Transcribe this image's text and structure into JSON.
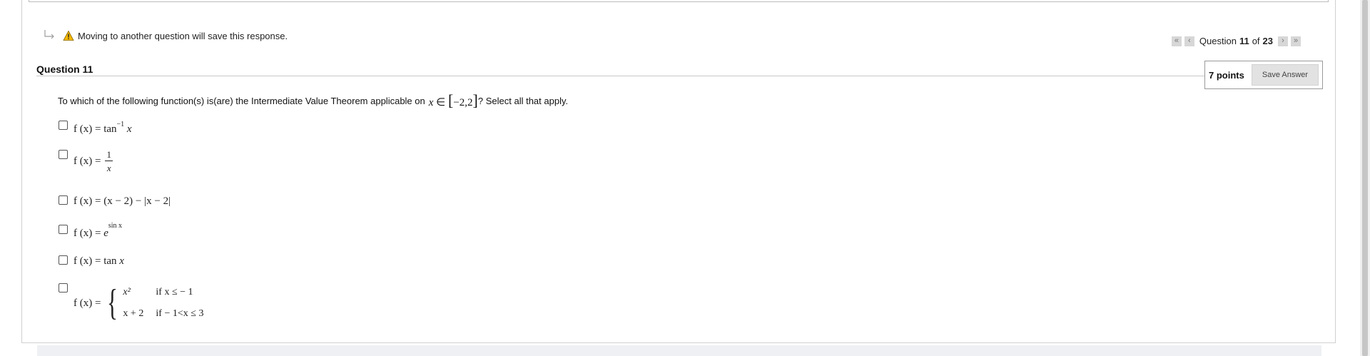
{
  "warning": {
    "text": "Moving to another question will save this response."
  },
  "nav": {
    "first": "«",
    "prev": "‹",
    "label_prefix": "Question",
    "current": "11",
    "label_of": "of",
    "total": "23",
    "next": "›",
    "last": "»"
  },
  "question": {
    "title": "Question 11",
    "points": "7 points",
    "save_label": "Save Answer",
    "prompt_before": "To which of the following function(s) is(are) the Intermediate Value Theorem applicable on",
    "prompt_after": "? Select all that apply.",
    "interval": {
      "var": "x",
      "op": "∈",
      "open": "[",
      "content": "−2,2",
      "close": "]"
    }
  },
  "options": [
    {
      "lhs": "f (x) = ",
      "fn": "tan",
      "sup": "−1",
      "arg": "x"
    },
    {
      "lhs": "f (x) = ",
      "num": "1",
      "den": "x"
    },
    {
      "lhs": "f (x) = ",
      "text": "(x − 2) − |x − 2|"
    },
    {
      "lhs": "f (x) = ",
      "base": "e",
      "sup": "sin x"
    },
    {
      "lhs": "f (x) = ",
      "fn": "tan",
      "arg": "x"
    },
    {
      "lhs": "f (x) = ",
      "cases": [
        {
          "expr": "x²",
          "cond": "if x ≤ − 1"
        },
        {
          "expr": "x + 2",
          "cond": "if − 1<x ≤ 3"
        }
      ]
    }
  ]
}
